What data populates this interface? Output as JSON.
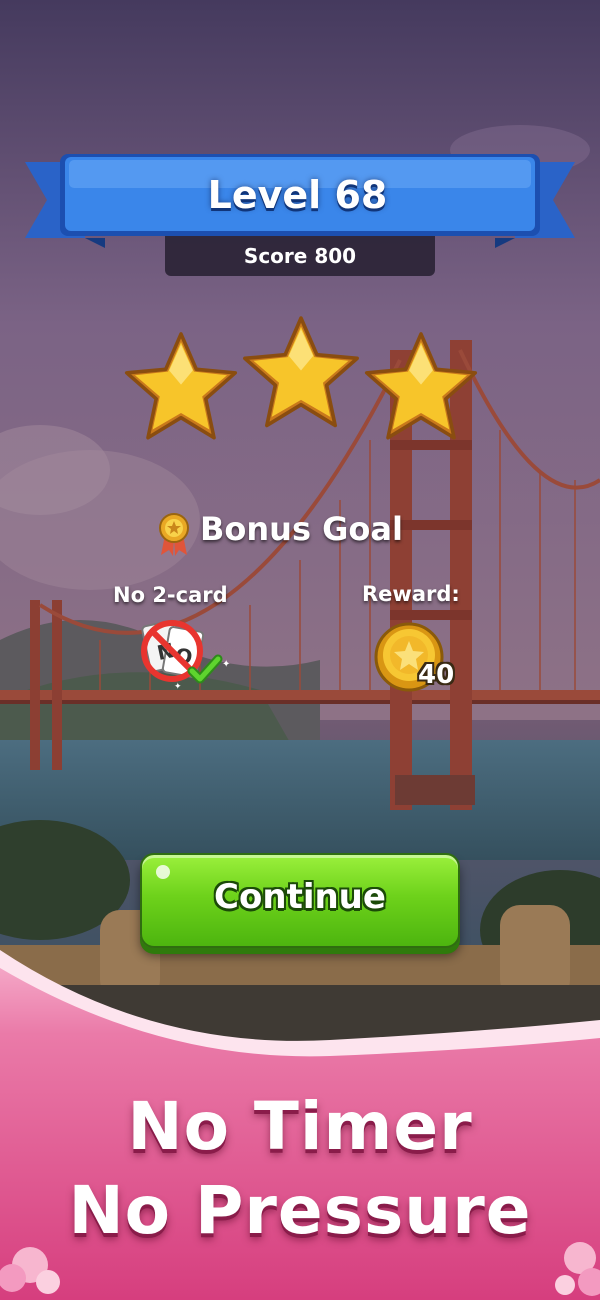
{
  "level": {
    "title": "Level 68",
    "score": "Score 800"
  },
  "stars": {
    "earned": 3,
    "total": 3
  },
  "bonus": {
    "title": "Bonus Goal",
    "goal_label": "No 2-card",
    "reward_label": "Reward:",
    "reward_amount": "40",
    "goal_completed": true
  },
  "continue_button": {
    "label": "Continue"
  },
  "promo": {
    "line1": "No Timer",
    "line2": "No Pressure"
  },
  "icons": {
    "medal": "medal-icon",
    "no_card": "no-card-icon",
    "check": "check-icon",
    "coin": "coin-icon",
    "star": "star-icon"
  },
  "colors": {
    "ribbon_blue": "#2f7ae0",
    "button_green": "#6ed21b",
    "star_gold": "#f7c52a",
    "promo_pink": "#e05591"
  }
}
